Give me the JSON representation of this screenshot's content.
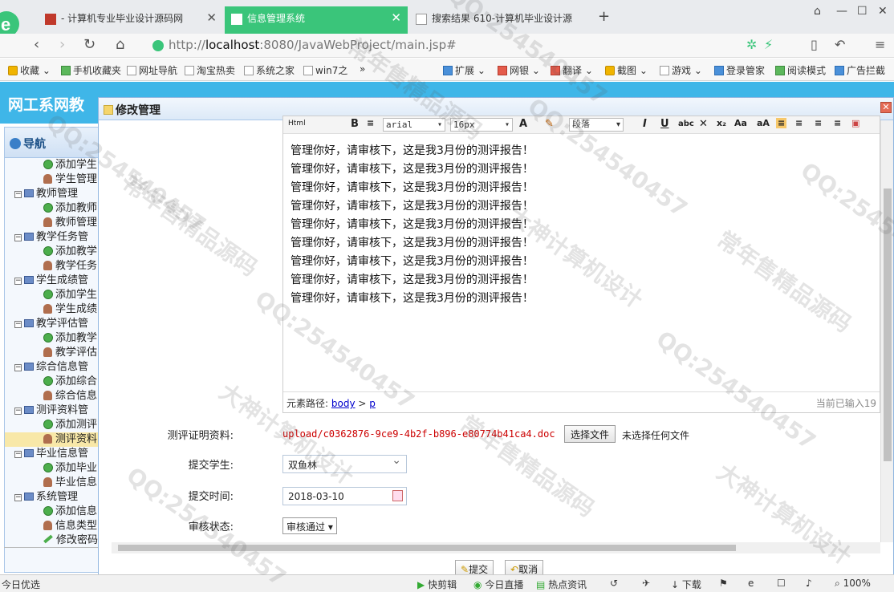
{
  "browser": {
    "tabs": [
      {
        "label": "- 计算机专业毕业设计源码网"
      },
      {
        "label": "信息管理系统"
      },
      {
        "label": "搜索结果 610-计算机毕业设计源"
      }
    ],
    "url_prefix": "http://",
    "url_host": "localhost",
    "url_rest": ":8080/JavaWebProject/main.jsp#",
    "bookmarks": [
      "收藏",
      "手机收藏夹",
      "网址导航",
      "淘宝热卖",
      "系统之家",
      "win7之",
      "»"
    ],
    "extensions": [
      "扩展",
      "网银",
      "翻译",
      "截图",
      "游戏",
      "登录管家",
      "阅读模式",
      "广告拦截"
    ]
  },
  "site": {
    "title": "网工系网教"
  },
  "sidebar": {
    "header": "导航",
    "items": [
      {
        "type": "leaf",
        "icon": "add",
        "label": "添加学生"
      },
      {
        "type": "leaf",
        "icon": "user",
        "label": "学生管理"
      },
      {
        "type": "node",
        "label": "教师管理"
      },
      {
        "type": "leaf",
        "icon": "add",
        "label": "添加教师"
      },
      {
        "type": "leaf",
        "icon": "user",
        "label": "教师管理"
      },
      {
        "type": "node",
        "label": "教学任务管"
      },
      {
        "type": "leaf",
        "icon": "add",
        "label": "添加教学"
      },
      {
        "type": "leaf",
        "icon": "user",
        "label": "教学任务"
      },
      {
        "type": "node",
        "label": "学生成绩管"
      },
      {
        "type": "leaf",
        "icon": "add",
        "label": "添加学生"
      },
      {
        "type": "leaf",
        "icon": "user",
        "label": "学生成绩"
      },
      {
        "type": "node",
        "label": "教学评估管"
      },
      {
        "type": "leaf",
        "icon": "add",
        "label": "添加教学"
      },
      {
        "type": "leaf",
        "icon": "user",
        "label": "教学评估"
      },
      {
        "type": "node",
        "label": "综合信息管"
      },
      {
        "type": "leaf",
        "icon": "add",
        "label": "添加综合"
      },
      {
        "type": "leaf",
        "icon": "user",
        "label": "综合信息"
      },
      {
        "type": "node",
        "label": "测评资料管"
      },
      {
        "type": "leaf",
        "icon": "add",
        "label": "添加测评"
      },
      {
        "type": "leaf",
        "icon": "user",
        "label": "测评资料",
        "selected": true
      },
      {
        "type": "node",
        "label": "毕业信息管"
      },
      {
        "type": "leaf",
        "icon": "add",
        "label": "添加毕业"
      },
      {
        "type": "leaf",
        "icon": "user",
        "label": "毕业信息"
      },
      {
        "type": "node",
        "label": "系统管理"
      },
      {
        "type": "leaf",
        "icon": "add",
        "label": "添加信息"
      },
      {
        "type": "leaf",
        "icon": "user",
        "label": "信息类型"
      },
      {
        "type": "leaf",
        "icon": "pen",
        "label": "修改密码"
      }
    ]
  },
  "dialog": {
    "title": "修改管理",
    "editor": {
      "toolbar": {
        "html_label": "Html",
        "bold": "B",
        "font_family": "arial",
        "font_size": "16px",
        "paragraph": "段落",
        "italic": "I",
        "underline": "U"
      },
      "lines": [
        "管理你好，请审核下，这是我3月份的测评报告！",
        "管理你好，请审核下，这是我3月份的测评报告！",
        "管理你好，请审核下，这是我3月份的测评报告！",
        "管理你好，请审核下，这是我3月份的测评报告！",
        "管理你好，请审核下，这是我3月份的测评报告！",
        "管理你好，请审核下，这是我3月份的测评报告！",
        "管理你好，请审核下，这是我3月份的测评报告！",
        "管理你好，请审核下，这是我3月份的测评报告！",
        "管理你好，请审核下，这是我3月份的测评报告！"
      ],
      "path_label": "元素路径:",
      "path_body": "body",
      "path_sep": ">",
      "path_p": "p",
      "count_text": "当前已输入19"
    },
    "form": {
      "doc_label": "测评证明资料:",
      "doc_path": "upload/c0362876-9ce9-4b2f-b896-e80774b41ca4.doc",
      "file_button": "选择文件",
      "file_none": "未选择任何文件",
      "student_label": "提交学生:",
      "student_value": "双鱼林",
      "time_label": "提交时间:",
      "time_value": "2018-03-10",
      "status_label": "审核状态:",
      "status_value": "审核通过"
    },
    "buttons": {
      "submit": "提交",
      "cancel": "取消"
    }
  },
  "statusbar": {
    "left": "今日优选",
    "items": [
      "快剪辑",
      "今日直播",
      "热点资讯",
      "下载",
      "100%"
    ]
  },
  "watermark": {
    "qq": "QQ:254540457",
    "shop": "常年售精品源码",
    "design": "大神计算机设计"
  }
}
